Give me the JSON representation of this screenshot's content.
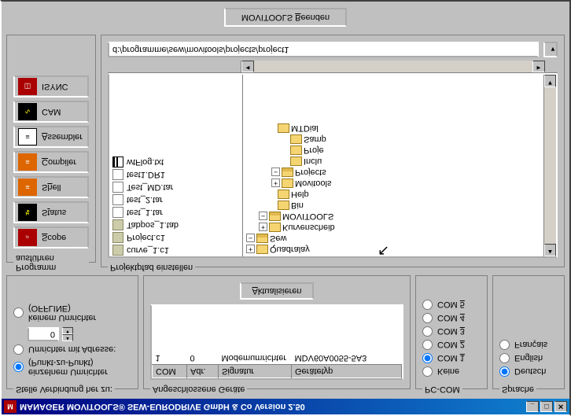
{
  "title": "MANAGER    MOVITOOLS®  SEW-EURODRIVE GmbH & Co    Version  2.50",
  "conn": {
    "legend": "Stelle Verbindung her zu:",
    "opt1a": "einzelnem Umrichter",
    "opt1b": "(Punkt-zu-Punkt)",
    "opt2": "Umrichter mit Adresse:",
    "addr": "0",
    "opt3a": "keinem Umrichter",
    "opt3b": "(OFFLINE)"
  },
  "devices": {
    "legend": "Angeschlossene Geräte",
    "cols": {
      "com": "COM",
      "adr": "Adr.",
      "sig": "Signatur",
      "typ": "Gerätetyp"
    },
    "row": {
      "com": "1",
      "adr": "0",
      "sig": "Modemumrichter",
      "typ": "MDV60A0055-5A3"
    },
    "refresh": "Aktualisieren"
  },
  "pccom": {
    "legend": "PC-COM",
    "none": "Keine",
    "com1": "COM 1",
    "com2": "COM 2",
    "com3": "COM 3",
    "com4": "COM 4",
    "com5": "COM 5"
  },
  "lang": {
    "legend": "Sprache",
    "de": "Deutsch",
    "en": "English",
    "fr": "Français"
  },
  "prog": {
    "legend": "Programm ausführen",
    "scope": "Scope",
    "status": "Status",
    "shell": "Shell",
    "compiler": "Compiler",
    "assembler": "Assembler",
    "cam": "CAM",
    "isync": "ISYNC"
  },
  "proj": {
    "legend": "Projektpfad einstellen",
    "path": "d:/programme/sew/movitools/projects/project1",
    "files": [
      {
        "name": "curve_1.c1",
        "kind": "spec"
      },
      {
        "name": "Project.c1",
        "kind": "spec"
      },
      {
        "name": "Tabpos_1.tab",
        "kind": "spec"
      },
      {
        "name": "test_1.tar",
        "kind": "dat"
      },
      {
        "name": "test_2.tar",
        "kind": "dat"
      },
      {
        "name": "Test_MD.tar",
        "kind": "dat"
      },
      {
        "name": "test1.DR1",
        "kind": "dat"
      },
      {
        "name": "wtFlog.txt",
        "kind": "txt"
      }
    ],
    "tree": {
      "n1": "Quadralay",
      "n2": "Sew",
      "n3": "Kurvenscheib",
      "n4": "MOVITOOLS",
      "n5": "Bin",
      "n6": "Help",
      "n7": "Movitools",
      "n8": "Projects",
      "n9": "Inclu",
      "n10": "Proje",
      "n11": "Samp",
      "n12": "MTDial"
    }
  },
  "exit": "MOVITOOLS Beenden"
}
